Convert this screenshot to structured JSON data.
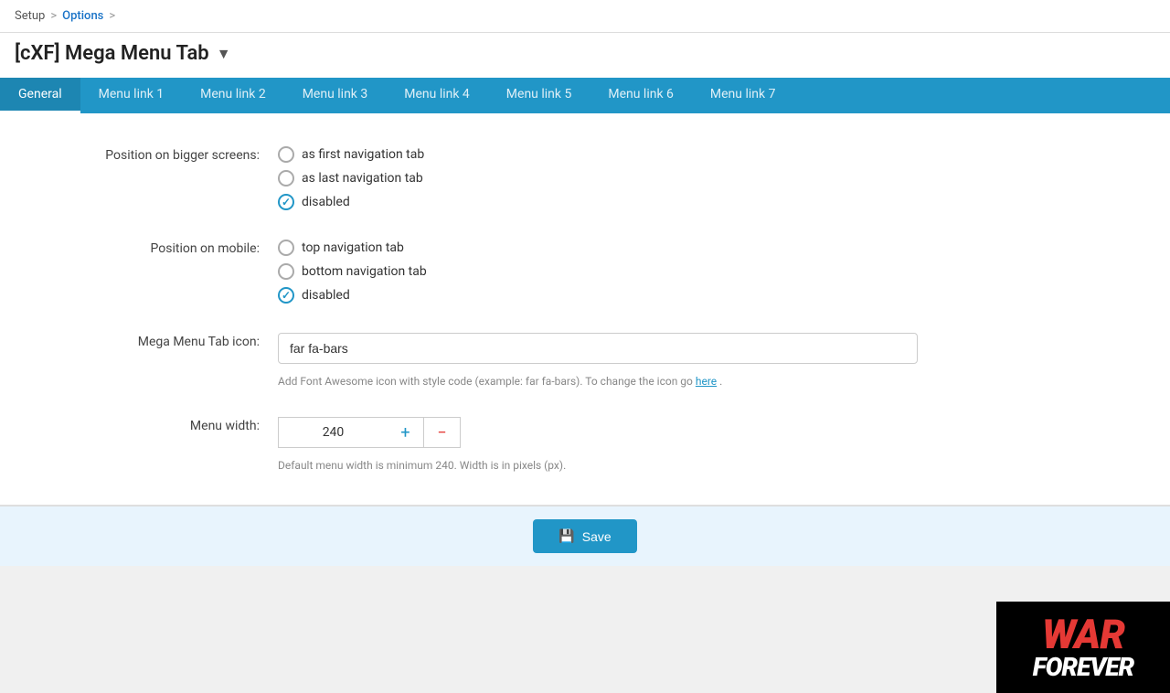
{
  "breadcrumb": {
    "setup": "Setup",
    "options": "Options",
    "sep1": ">",
    "sep2": ">"
  },
  "page": {
    "title": "[cXF] Mega Menu Tab",
    "dropdown_arrow": "▼"
  },
  "tabs": [
    {
      "label": "General",
      "active": true
    },
    {
      "label": "Menu link 1",
      "active": false
    },
    {
      "label": "Menu link 2",
      "active": false
    },
    {
      "label": "Menu link 3",
      "active": false
    },
    {
      "label": "Menu link 4",
      "active": false
    },
    {
      "label": "Menu link 5",
      "active": false
    },
    {
      "label": "Menu link 6",
      "active": false
    },
    {
      "label": "Menu link 7",
      "active": false
    }
  ],
  "form": {
    "position_bigger_label": "Position on bigger screens:",
    "position_bigger_options": [
      {
        "label": "as first navigation tab",
        "state": "unchecked"
      },
      {
        "label": "as last navigation tab",
        "state": "unchecked"
      },
      {
        "label": "disabled",
        "state": "checked"
      }
    ],
    "position_mobile_label": "Position on mobile:",
    "position_mobile_options": [
      {
        "label": "top navigation tab",
        "state": "unchecked"
      },
      {
        "label": "bottom navigation tab",
        "state": "unchecked"
      },
      {
        "label": "disabled",
        "state": "checked"
      }
    ],
    "icon_label": "Mega Menu Tab icon:",
    "icon_value": "far fa-bars",
    "icon_hint": "Add Font Awesome icon with style code (example: far fa-bars). To change the icon go ",
    "icon_hint_link": "here",
    "icon_hint_end": ".",
    "menu_width_label": "Menu width:",
    "menu_width_value": "240",
    "menu_width_hint": "Default menu width is minimum 240. Width is in pixels (px).",
    "stepper_plus": "+",
    "stepper_minus": "−"
  },
  "save_button": "Save"
}
